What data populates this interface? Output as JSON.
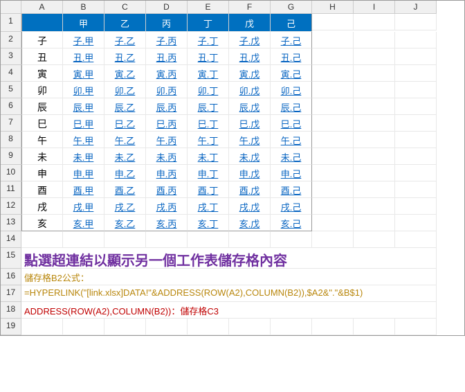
{
  "columns": [
    "A",
    "B",
    "C",
    "D",
    "E",
    "F",
    "G",
    "H",
    "I",
    "J"
  ],
  "row_numbers": [
    1,
    2,
    3,
    4,
    5,
    6,
    7,
    8,
    9,
    10,
    11,
    12,
    13,
    14,
    15,
    16,
    17,
    18,
    19
  ],
  "header_row": [
    "",
    "甲",
    "乙",
    "丙",
    "丁",
    "戊",
    "己"
  ],
  "row_labels": [
    "子",
    "丑",
    "寅",
    "卯",
    "辰",
    "巳",
    "午",
    "未",
    "申",
    "酉",
    "戌",
    "亥"
  ],
  "links": [
    [
      "子.甲",
      "子.乙",
      "子.丙",
      "子.丁",
      "子.戊",
      "子.己"
    ],
    [
      "丑.甲",
      "丑.乙",
      "丑.丙",
      "丑.丁",
      "丑.戊",
      "丑.己"
    ],
    [
      "寅.甲",
      "寅.乙",
      "寅.丙",
      "寅.丁",
      "寅.戊",
      "寅.己"
    ],
    [
      "卯.甲",
      "卯.乙",
      "卯.丙",
      "卯.丁",
      "卯.戊",
      "卯.己"
    ],
    [
      "辰.甲",
      "辰.乙",
      "辰.丙",
      "辰.丁",
      "辰.戊",
      "辰.己"
    ],
    [
      "巳.甲",
      "巳.乙",
      "巳.丙",
      "巳.丁",
      "巳.戊",
      "巳.己"
    ],
    [
      "午.甲",
      "午.乙",
      "午.丙",
      "午.丁",
      "午.戊",
      "午.己"
    ],
    [
      "未.甲",
      "未.乙",
      "未.丙",
      "未.丁",
      "未.戊",
      "未.己"
    ],
    [
      "申.甲",
      "申.乙",
      "申.丙",
      "申.丁",
      "申.戊",
      "申.己"
    ],
    [
      "酉.甲",
      "酉.乙",
      "酉.丙",
      "酉.丁",
      "酉.戊",
      "酉.己"
    ],
    [
      "戌.甲",
      "戌.乙",
      "戌.丙",
      "戌.丁",
      "戌.戊",
      "戌.己"
    ],
    [
      "亥.甲",
      "亥.乙",
      "亥.丙",
      "亥.丁",
      "亥.戊",
      "亥.己"
    ]
  ],
  "instruction": "點選超連結以顯示另一個工作表儲存格內容",
  "formula_label": "儲存格B2公式：",
  "formula": "=HYPERLINK(\"[link.xlsx]DATA!\"&ADDRESS(ROW(A2),COLUMN(B2)),$A2&\".\"&B$1)",
  "formula_note": "ADDRESS(ROW(A2),COLUMN(B2))：儲存格C3"
}
